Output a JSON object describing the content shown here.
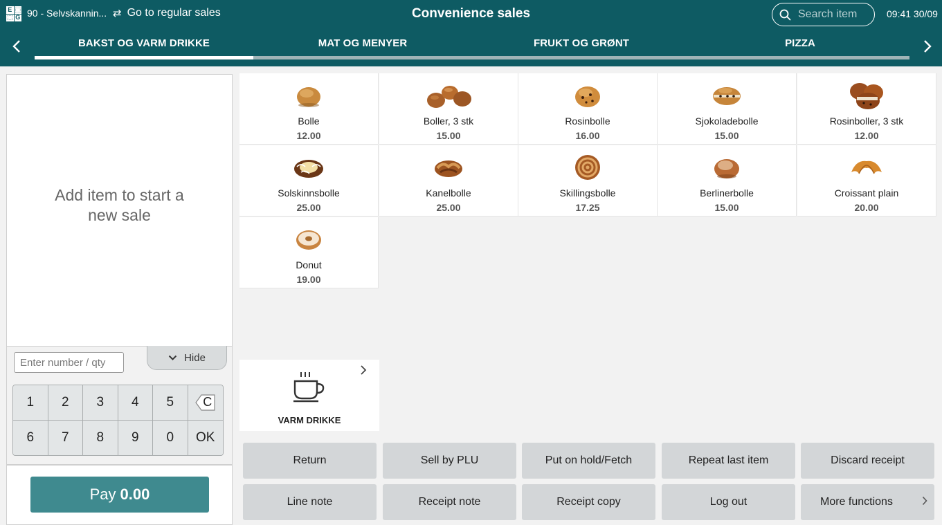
{
  "header": {
    "logo_letters": [
      "E",
      "⬚",
      "⬚",
      "G"
    ],
    "store": "90 - Selvskannin...",
    "regular_sales": "Go to regular sales",
    "title": "Convenience sales",
    "search_placeholder": "Search item",
    "clock": "09:41 30/09",
    "bg_color": "#0e5b63"
  },
  "tabs": [
    {
      "label": "BAKST OG VARM DRIKKE",
      "active": true
    },
    {
      "label": "MAT OG MENYER",
      "active": false
    },
    {
      "label": "FRUKT OG GRØNT",
      "active": false
    },
    {
      "label": "PIZZA",
      "active": false
    }
  ],
  "receipt": {
    "empty_line1": "Add item to start a",
    "empty_line2": "new sale"
  },
  "keypad": {
    "input_placeholder": "Enter number / qty",
    "hide_label": "Hide",
    "keys": [
      "1",
      "2",
      "3",
      "4",
      "5",
      "C",
      "6",
      "7",
      "8",
      "9",
      "0",
      "OK"
    ]
  },
  "pay": {
    "label": "Pay",
    "amount": "0.00",
    "color": "#3f8a8f"
  },
  "products": [
    {
      "name": "Bolle",
      "price": "12.00",
      "icon": "bun"
    },
    {
      "name": "Boller, 3 stk",
      "price": "15.00",
      "icon": "buns-three"
    },
    {
      "name": "Rosinbolle",
      "price": "16.00",
      "icon": "raisin-bun"
    },
    {
      "name": "Sjokoladebolle",
      "price": "15.00",
      "icon": "chocolate-bun"
    },
    {
      "name": "Rosinboller, 3 stk",
      "price": "12.00",
      "icon": "raisin-buns-three"
    },
    {
      "name": "Solskinnsbolle",
      "price": "25.00",
      "icon": "sunshine-bun"
    },
    {
      "name": "Kanelbolle",
      "price": "25.00",
      "icon": "cinnamon-bun"
    },
    {
      "name": "Skillingsbolle",
      "price": "17.25",
      "icon": "swirl-bun"
    },
    {
      "name": "Berlinerbolle",
      "price": "15.00",
      "icon": "berliner"
    },
    {
      "name": "Croissant plain",
      "price": "20.00",
      "icon": "croissant"
    },
    {
      "name": "Donut",
      "price": "19.00",
      "icon": "donut"
    }
  ],
  "category": {
    "label": "VARM DRIKKE",
    "icon": "coffee-cup"
  },
  "functions": [
    {
      "label": "Return"
    },
    {
      "label": "Sell by PLU"
    },
    {
      "label": "Put on hold/Fetch"
    },
    {
      "label": "Repeat last item"
    },
    {
      "label": "Discard receipt"
    },
    {
      "label": "Line note"
    },
    {
      "label": "Receipt note"
    },
    {
      "label": "Receipt copy"
    },
    {
      "label": "Log out"
    },
    {
      "label": "More functions"
    }
  ]
}
